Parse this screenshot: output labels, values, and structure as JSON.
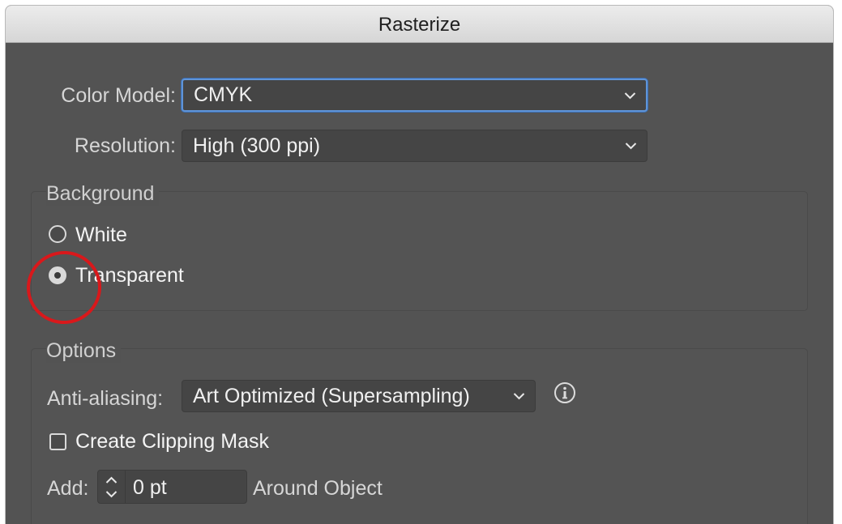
{
  "window": {
    "title": "Rasterize"
  },
  "color_model": {
    "label": "Color Model:",
    "value": "CMYK"
  },
  "resolution": {
    "label": "Resolution:",
    "value": "High (300 ppi)"
  },
  "background": {
    "title": "Background",
    "options": [
      {
        "label": "White",
        "selected": false
      },
      {
        "label": "Transparent",
        "selected": true
      }
    ]
  },
  "options": {
    "title": "Options",
    "anti_aliasing": {
      "label": "Anti-aliasing:",
      "value": "Art Optimized (Supersampling)"
    },
    "clipping_mask": {
      "label": "Create Clipping Mask",
      "checked": false
    },
    "add": {
      "label": "Add:",
      "value": "0 pt",
      "suffix": "Around Object"
    }
  },
  "icons": {
    "chevron": "chevron-down-icon",
    "info": "info-icon",
    "stepper": "stepper-arrows-icon"
  },
  "colors": {
    "dialog_bg": "#535353",
    "focus_ring": "#5f94d8",
    "annotation": "#d9181b"
  }
}
